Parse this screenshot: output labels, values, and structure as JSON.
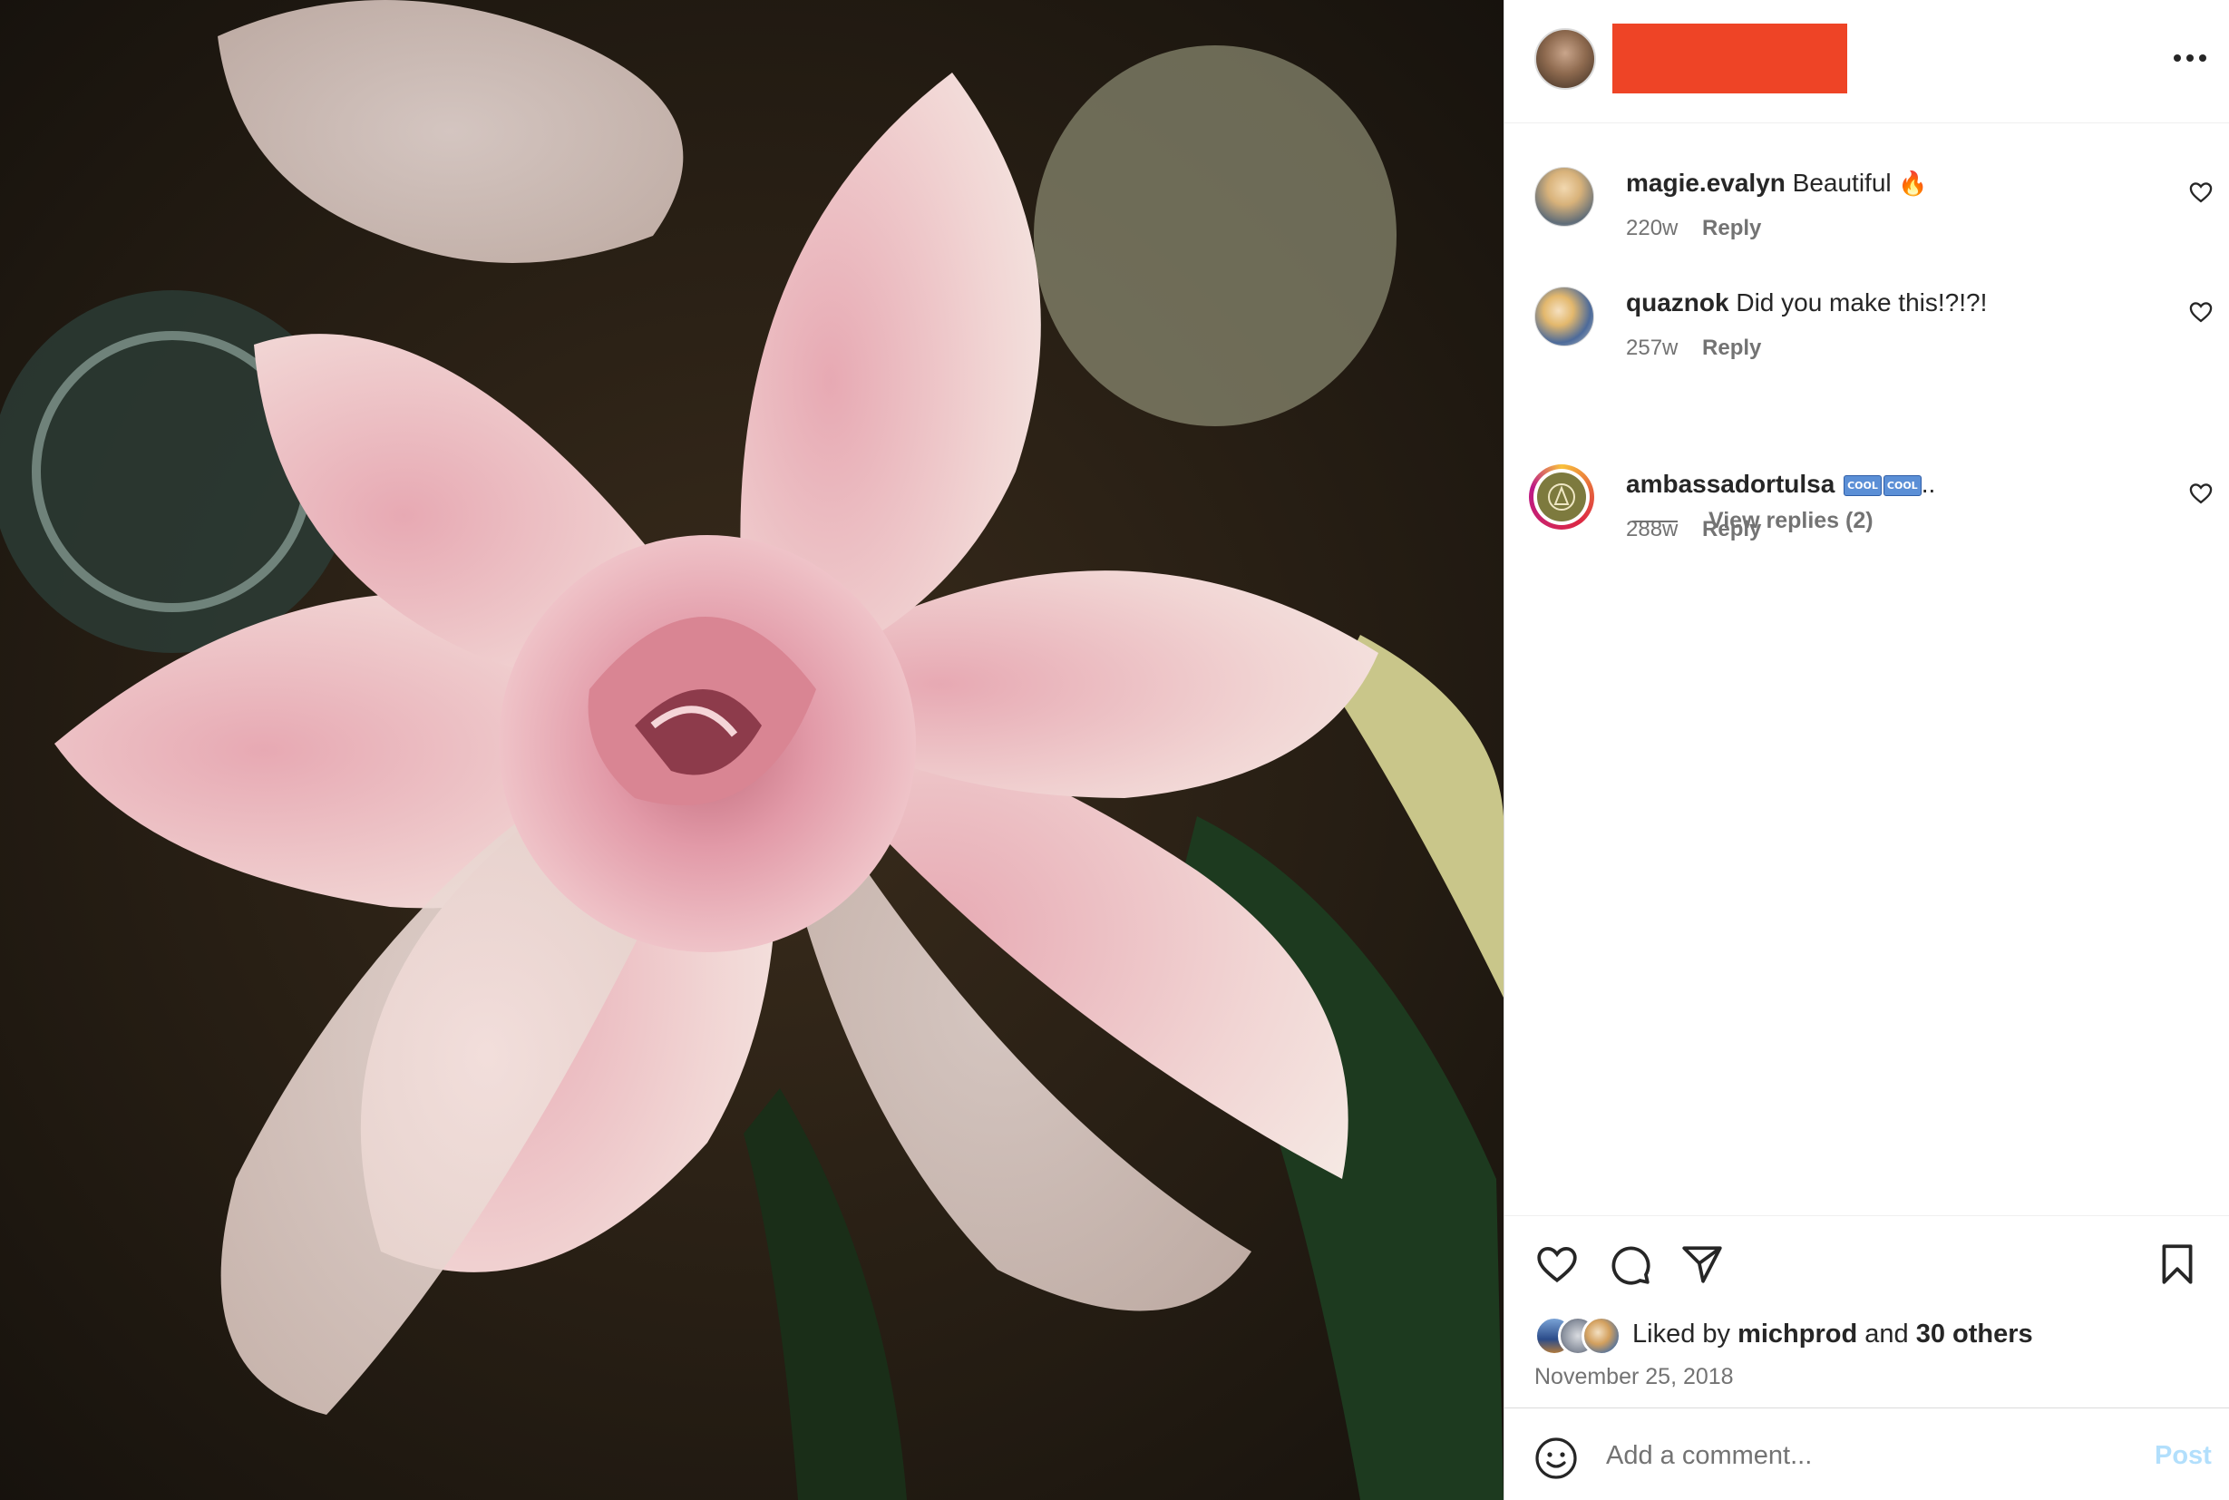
{
  "post": {
    "author_redacted_color": "#ee4426",
    "image_description_icon": "pink-lily-photo"
  },
  "comments": [
    {
      "username": "magie.evalyn",
      "text": "Beautiful ",
      "emoji": "🔥",
      "age": "220w",
      "reply": "Reply"
    },
    {
      "username": "quaznok",
      "text": "Did you make this!?!?!",
      "emoji": "",
      "age": "257w",
      "reply": "Reply",
      "view_replies": "View replies (2)"
    },
    {
      "username": "ambassadortulsa",
      "text": "..",
      "badges": [
        "COOL",
        "COOL"
      ],
      "age": "288w",
      "reply": "Reply"
    }
  ],
  "likes": {
    "prefix": "Liked by ",
    "user": "michprod",
    "middle": " and ",
    "others": "30 others"
  },
  "date": "November 25, 2018",
  "add_comment": {
    "placeholder": "Add a comment...",
    "post_label": "Post"
  },
  "colors": {
    "accent_blue_disabled": "#b2dffc",
    "muted_text": "#737373"
  }
}
